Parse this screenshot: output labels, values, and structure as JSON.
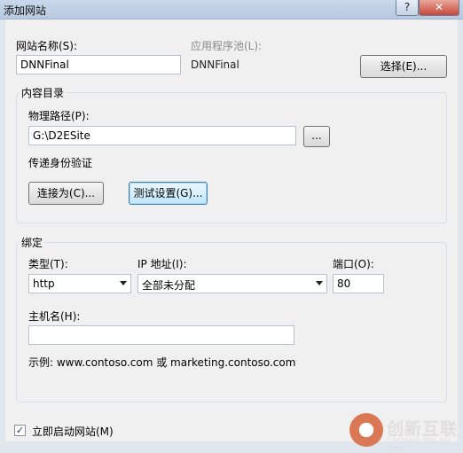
{
  "window": {
    "title": "添加网站",
    "help_label": "?",
    "close_label": "✕"
  },
  "site": {
    "name_label": "网站名称(S):",
    "name_value": "DNNFinal",
    "pool_label": "应用程序池(L):",
    "pool_value": "DNNFinal",
    "select_button": "选择(E)..."
  },
  "content": {
    "group_title": "内容目录",
    "path_label": "物理路径(P):",
    "path_value": "G:\\D2ESite",
    "browse_button": "...",
    "pass_through_label": "传递身份验证",
    "connect_as_button": "连接为(C)...",
    "test_settings_button": "测试设置(G)..."
  },
  "binding": {
    "group_title": "绑定",
    "type_label": "类型(T):",
    "type_value": "http",
    "ip_label": "IP 地址(I):",
    "ip_value": "全部未分配",
    "port_label": "端口(O):",
    "port_value": "80",
    "host_label": "主机名(H):",
    "host_value": "",
    "example_text": "示例: www.contoso.com 或 marketing.contoso.com"
  },
  "start": {
    "label": "立即启动网站(M)",
    "checked": true,
    "check_glyph": "✓"
  },
  "watermark": {
    "cn": "创新互联",
    "en": "CHUANG XIN HU LIAN"
  }
}
